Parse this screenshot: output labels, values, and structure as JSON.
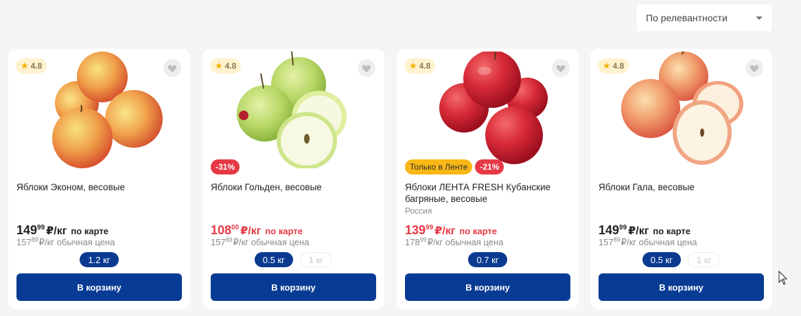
{
  "sort": {
    "label": "По релевантности",
    "icon": "chevron-down-icon"
  },
  "products": [
    {
      "rating": "4.8",
      "badges": [],
      "name": "Яблоки Эконом, весовые",
      "origin": "",
      "price_main": "149",
      "price_cents": "99",
      "price_unit": "₽/кг",
      "price_label": "по карте",
      "price_red": false,
      "regular_main": "157",
      "regular_cents": "89",
      "regular_text": "₽/кг обычная цена",
      "weights": [
        "1.2 кг"
      ],
      "cart": "В корзину"
    },
    {
      "rating": "4.8",
      "badges": [
        "-31%"
      ],
      "name": "Яблоки Гольден, весовые",
      "origin": "",
      "price_main": "108",
      "price_cents": "00",
      "price_unit": "₽/кг",
      "price_label": "по карте",
      "price_red": true,
      "regular_main": "157",
      "regular_cents": "89",
      "regular_text": "₽/кг обычная цена",
      "weights": [
        "0.5 кг",
        "1 кг"
      ],
      "cart": "В корзину"
    },
    {
      "rating": "4.8",
      "badges": [
        "Только в Ленте",
        "-21%"
      ],
      "name": "Яблоки ЛЕНТА FRESH Кубанские багряные, весовые",
      "origin": "Россия",
      "price_main": "139",
      "price_cents": "99",
      "price_unit": "₽/кг",
      "price_label": "по карте",
      "price_red": true,
      "regular_main": "178",
      "regular_cents": "99",
      "regular_text": "₽/кг обычная цена",
      "weights": [
        "0.7 кг"
      ],
      "cart": "В корзину"
    },
    {
      "rating": "4.8",
      "badges": [],
      "name": "Яблоки Гала, весовые",
      "origin": "",
      "price_main": "149",
      "price_cents": "99",
      "price_unit": "₽/кг",
      "price_label": "по карте",
      "price_red": false,
      "regular_main": "157",
      "regular_cents": "89",
      "regular_text": "₽/кг обычная цена",
      "weights": [
        "0.5 кг",
        "1 кг"
      ],
      "cart": "В корзину"
    }
  ],
  "colors": {
    "primary": "#073b94",
    "discount": "#e63946",
    "only_badge": "#f9b815",
    "rating_bg": "#fff2cf",
    "star": "#f4b000"
  }
}
